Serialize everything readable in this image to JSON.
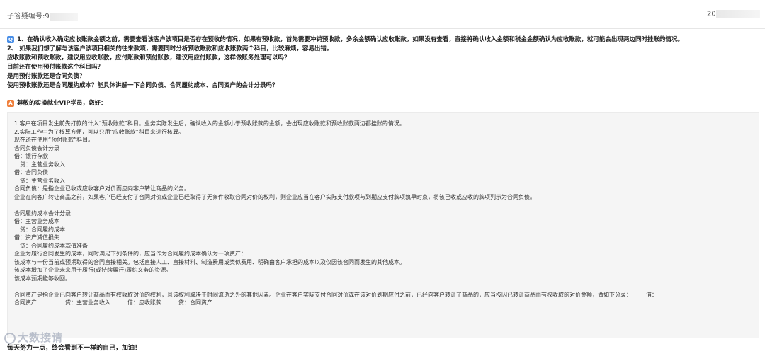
{
  "header": {
    "qid_label": "子答疑编号:9",
    "date_prefix": "20"
  },
  "question": {
    "lines": [
      "1、在确认收入确定应收账款金额之前，需要查看该客户该项目是否存在预收的情况，如果有预收款，首先需要冲销预收款，多余金额确认应收账款。如果没有查看，直接将确认收入金额和税金金额确认为应收账款，就可能会出现两边同时挂账的情况。",
      "2、 如果我们想了解与该客户该项目相关的往来款项，需要同时分析预收账款和应收账款两个科目，比较麻烦，容易出错。",
      "应收账款和预收账款，建议用应收账款，应付账款和预付账款，建议用应付账款，这样做账务处理可以吗？",
      "目前还在使用预付账款这个科目吗？",
      "是用预付账款还是合同负债？",
      "使用预收账款还是合同履约成本？能具体讲解一下合同负债、合同履约成本、合同资产的会计分录吗？"
    ]
  },
  "answer": {
    "title": "尊敬的实操就业VIP学员，您好：",
    "lines": [
      "1.客户在项目发生前先打款的计入“预收账款”科目。业务实际发生后，确认收入的金额小于预收账款的金额，会出现应收账款和预收账款两边都挂账的情况。",
      "2.实际工作中为了核算方便，可以只用“应收账款”科目来进行核算。",
      "现在还在使用“预付账款”科目。",
      "合同负债会计分录",
      "借：银行存款",
      "　贷：主营业务收入",
      "借：合同负债",
      "　贷：主营业务收入",
      "合同负债：是指企业已收或应收客户对价而应向客户转让商品的义务。",
      "企业在向客户转让商品之前，如果客户已经支付了合同对价或企业已经取得了无条件收取合同对价的权利，则企业应当在客户实际支付款项与到期应支付款项孰早时点，将该已收或应收的款项列示为合同负债。",
      "",
      "合同履约成本会计分录",
      "借：主营业务成本",
      "　贷：合同履约成本",
      "借：资产减值损失",
      "　贷：合同履约成本减值准备",
      "企业为履行合同发生的成本，同时满足下列条件的，应当作为合同履约成本确认为一项资产：",
      "该成本与一份当前或预期取得的合同直接相关。包括直接人工、直接材料、制造费用或类似费用、明确由客户承担的成本以及仅因该合同而发生的其他成本。",
      "该成本增加了企业未来用于履行(或持续履行)履约义务的资源。",
      "该成本预期能够收回。",
      "",
      "合同资产是指企业已向客户转让商品而有权收取对价的权利，且该权利取决于时间流逝之外的其他因素。企业在客户实际支付合同对价或在该对价到期应付之前，已经向客户转让了商品的，应当按因已转让商品而有权收取的对价金额，做如下分录：　　　借：",
      "合同资产　　　　　贷：主营业务收入　　　借：应收账款　　　贷：合同资产"
    ]
  },
  "watermark": "大数接请",
  "footer": "每天努力一点，终会看到不一样的自己，加油！",
  "colors": {
    "question_badge": "#4a8fe7",
    "answer_badge": "#f0803c",
    "answer_bg": "#f5f5f5"
  }
}
